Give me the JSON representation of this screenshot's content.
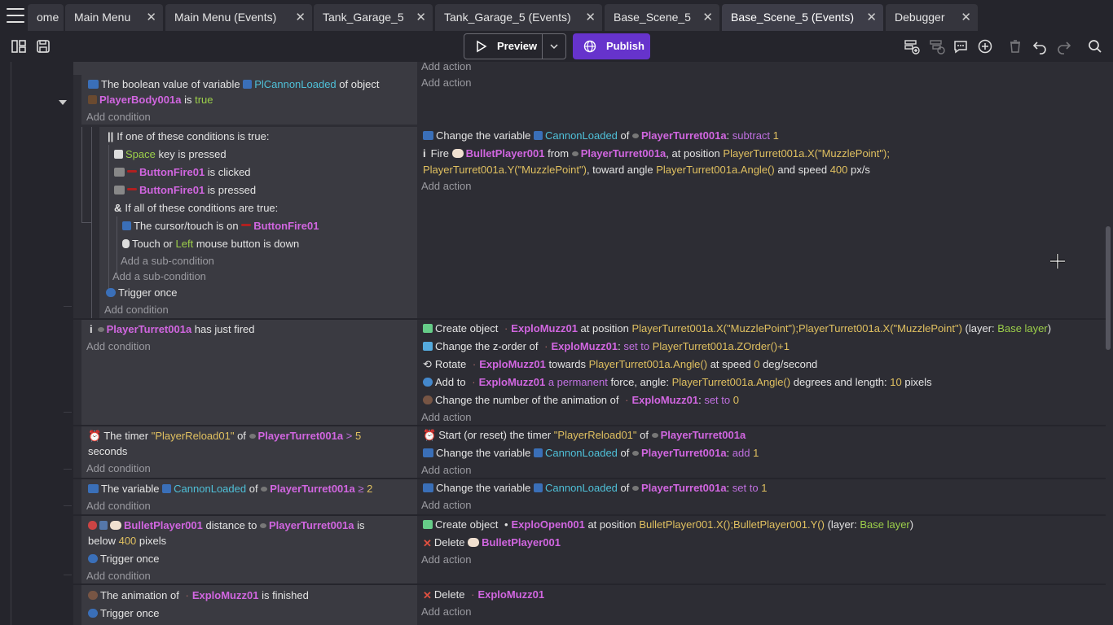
{
  "tabs": [
    {
      "label": "ome"
    },
    {
      "label": "Main Menu"
    },
    {
      "label": "Main Menu (Events)"
    },
    {
      "label": "Tank_Garage_5"
    },
    {
      "label": "Tank_Garage_5 (Events)"
    },
    {
      "label": "Base_Scene_5"
    },
    {
      "label": "Base_Scene_5 (Events)"
    },
    {
      "label": "Debugger"
    }
  ],
  "toolbar": {
    "preview_label": "Preview",
    "publish_label": "Publish"
  },
  "events": {
    "top": {
      "a1": "Add action",
      "a2": "Add action"
    },
    "e1": {
      "c1": "The boolean value of variable",
      "c1_var": "PlCannonLoaded",
      "c1_b": "of object",
      "c2_obj": "PlayerBody001a",
      "c2_b": "is",
      "c2_val": "true",
      "add_cond": "Add condition"
    },
    "e2": {
      "or": "If one of these conditions is true:",
      "k1": "Space",
      "k1b": "key is pressed",
      "b1": "ButtonFire01",
      "b1b": "is clicked",
      "b2": "ButtonFire01",
      "b2b": "is pressed",
      "and": "If all of these conditions are true:",
      "cur": "The cursor/touch is on",
      "cur_obj": "ButtonFire01",
      "touch": "Touch or",
      "touch_btn": "Left",
      "touch_b": "mouse button is down",
      "add_sub1": "Add a sub-condition",
      "add_sub2": "Add a sub-condition",
      "trig": "Trigger once",
      "add_cond": "Add condition",
      "a1": "Change the variable",
      "a1_var": "CannonLoaded",
      "a1_of": "of",
      "a1_obj": "PlayerTurret001a",
      "a1_op": "subtract",
      "a1_val": "1",
      "a2": "Fire",
      "a2_obj": "BulletPlayer001",
      "a2_from": "from",
      "a2_obj2": "PlayerTurret001a",
      "a2_pos": ", at position",
      "a2_x": "PlayerTurret001a.X(\"MuzzlePoint\");",
      "a2_y": "PlayerTurret001a.Y(\"MuzzlePoint\")",
      "a2_to": ", toward angle",
      "a2_ang": "PlayerTurret001a.Angle()",
      "a2_and": "and speed",
      "a2_spd": "400",
      "a2_unit": "px/s",
      "add_act": "Add action"
    },
    "e3": {
      "c_obj": "PlayerTurret001a",
      "c": "has just fired",
      "add_cond": "Add condition",
      "a1": "Create object",
      "a1_obj": "ExploMuzz01",
      "a1_pos": "at position",
      "a1_expr": "PlayerTurret001a.X(\"MuzzlePoint\");PlayerTurret001a.X(\"MuzzlePoint\")",
      "a1_layer": "(layer:",
      "a1_layer_v": "Base layer",
      "a1_close": ")",
      "a2": "Change the z-order of",
      "a2_obj": "ExploMuzz01",
      "a2_set": "set to",
      "a2_expr": "PlayerTurret001a.ZOrder()+1",
      "a3": "Rotate",
      "a3_obj": "ExploMuzz01",
      "a3_t": "towards",
      "a3_expr": "PlayerTurret001a.Angle()",
      "a3_at": "at speed",
      "a3_v": "0",
      "a3_u": "deg/second",
      "a4": "Add to",
      "a4_obj": "ExploMuzz01",
      "a4_perm": "a permanent",
      "a4_f": "force, angle:",
      "a4_expr": "PlayerTurret001a.Angle()",
      "a4_d": "degrees and length:",
      "a4_v": "10",
      "a4_u": "pixels",
      "a5": "Change the number of the animation of",
      "a5_obj": "ExploMuzz01",
      "a5_set": "set to",
      "a5_v": "0",
      "add_act": "Add action"
    },
    "e4": {
      "c": "The timer",
      "c_str": "\"PlayerReload01\"",
      "c_of": "of",
      "c_obj": "PlayerTurret001a",
      "c_op": ">",
      "c_v": "5",
      "c_sec": "seconds",
      "add_cond": "Add condition",
      "a1": "Start (or reset) the timer",
      "a1_str": "\"PlayerReload01\"",
      "a1_of": "of",
      "a1_obj": "PlayerTurret001a",
      "a2": "Change the variable",
      "a2_var": "CannonLoaded",
      "a2_of": "of",
      "a2_obj": "PlayerTurret001a",
      "a2_op": "add",
      "a2_v": "1",
      "add_act": "Add action"
    },
    "e5": {
      "c": "The variable",
      "c_var": "CannonLoaded",
      "c_of": "of",
      "c_obj": "PlayerTurret001a",
      "c_op": "≥",
      "c_v": "2",
      "add_cond": "Add condition",
      "a1": "Change the variable",
      "a1_var": "CannonLoaded",
      "a1_of": "of",
      "a1_obj": "PlayerTurret001a",
      "a1_op": "set to",
      "a1_v": "1",
      "add_act": "Add action"
    },
    "e6": {
      "c_obj": "BulletPlayer001",
      "c": "distance to",
      "c_obj2": "PlayerTurret001a",
      "c_is": "is",
      "c_below": "below",
      "c_v": "400",
      "c_u": "pixels",
      "trig": "Trigger once",
      "add_cond": "Add condition",
      "a1": "Create object",
      "a1_obj": "ExploOpen001",
      "a1_pos": "at position",
      "a1_expr": "BulletPlayer001.X();BulletPlayer001.Y()",
      "a1_layer": "(layer:",
      "a1_layer_v": "Base layer",
      "a1_close": ")",
      "a2": "Delete",
      "a2_obj": "BulletPlayer001",
      "add_act": "Add action"
    },
    "e7": {
      "c": "The animation of",
      "c_obj": "ExploMuzz01",
      "c_b": "is finished",
      "trig": "Trigger once",
      "a1": "Delete",
      "a1_obj": "ExploMuzz01",
      "add_act": "Add action"
    }
  }
}
